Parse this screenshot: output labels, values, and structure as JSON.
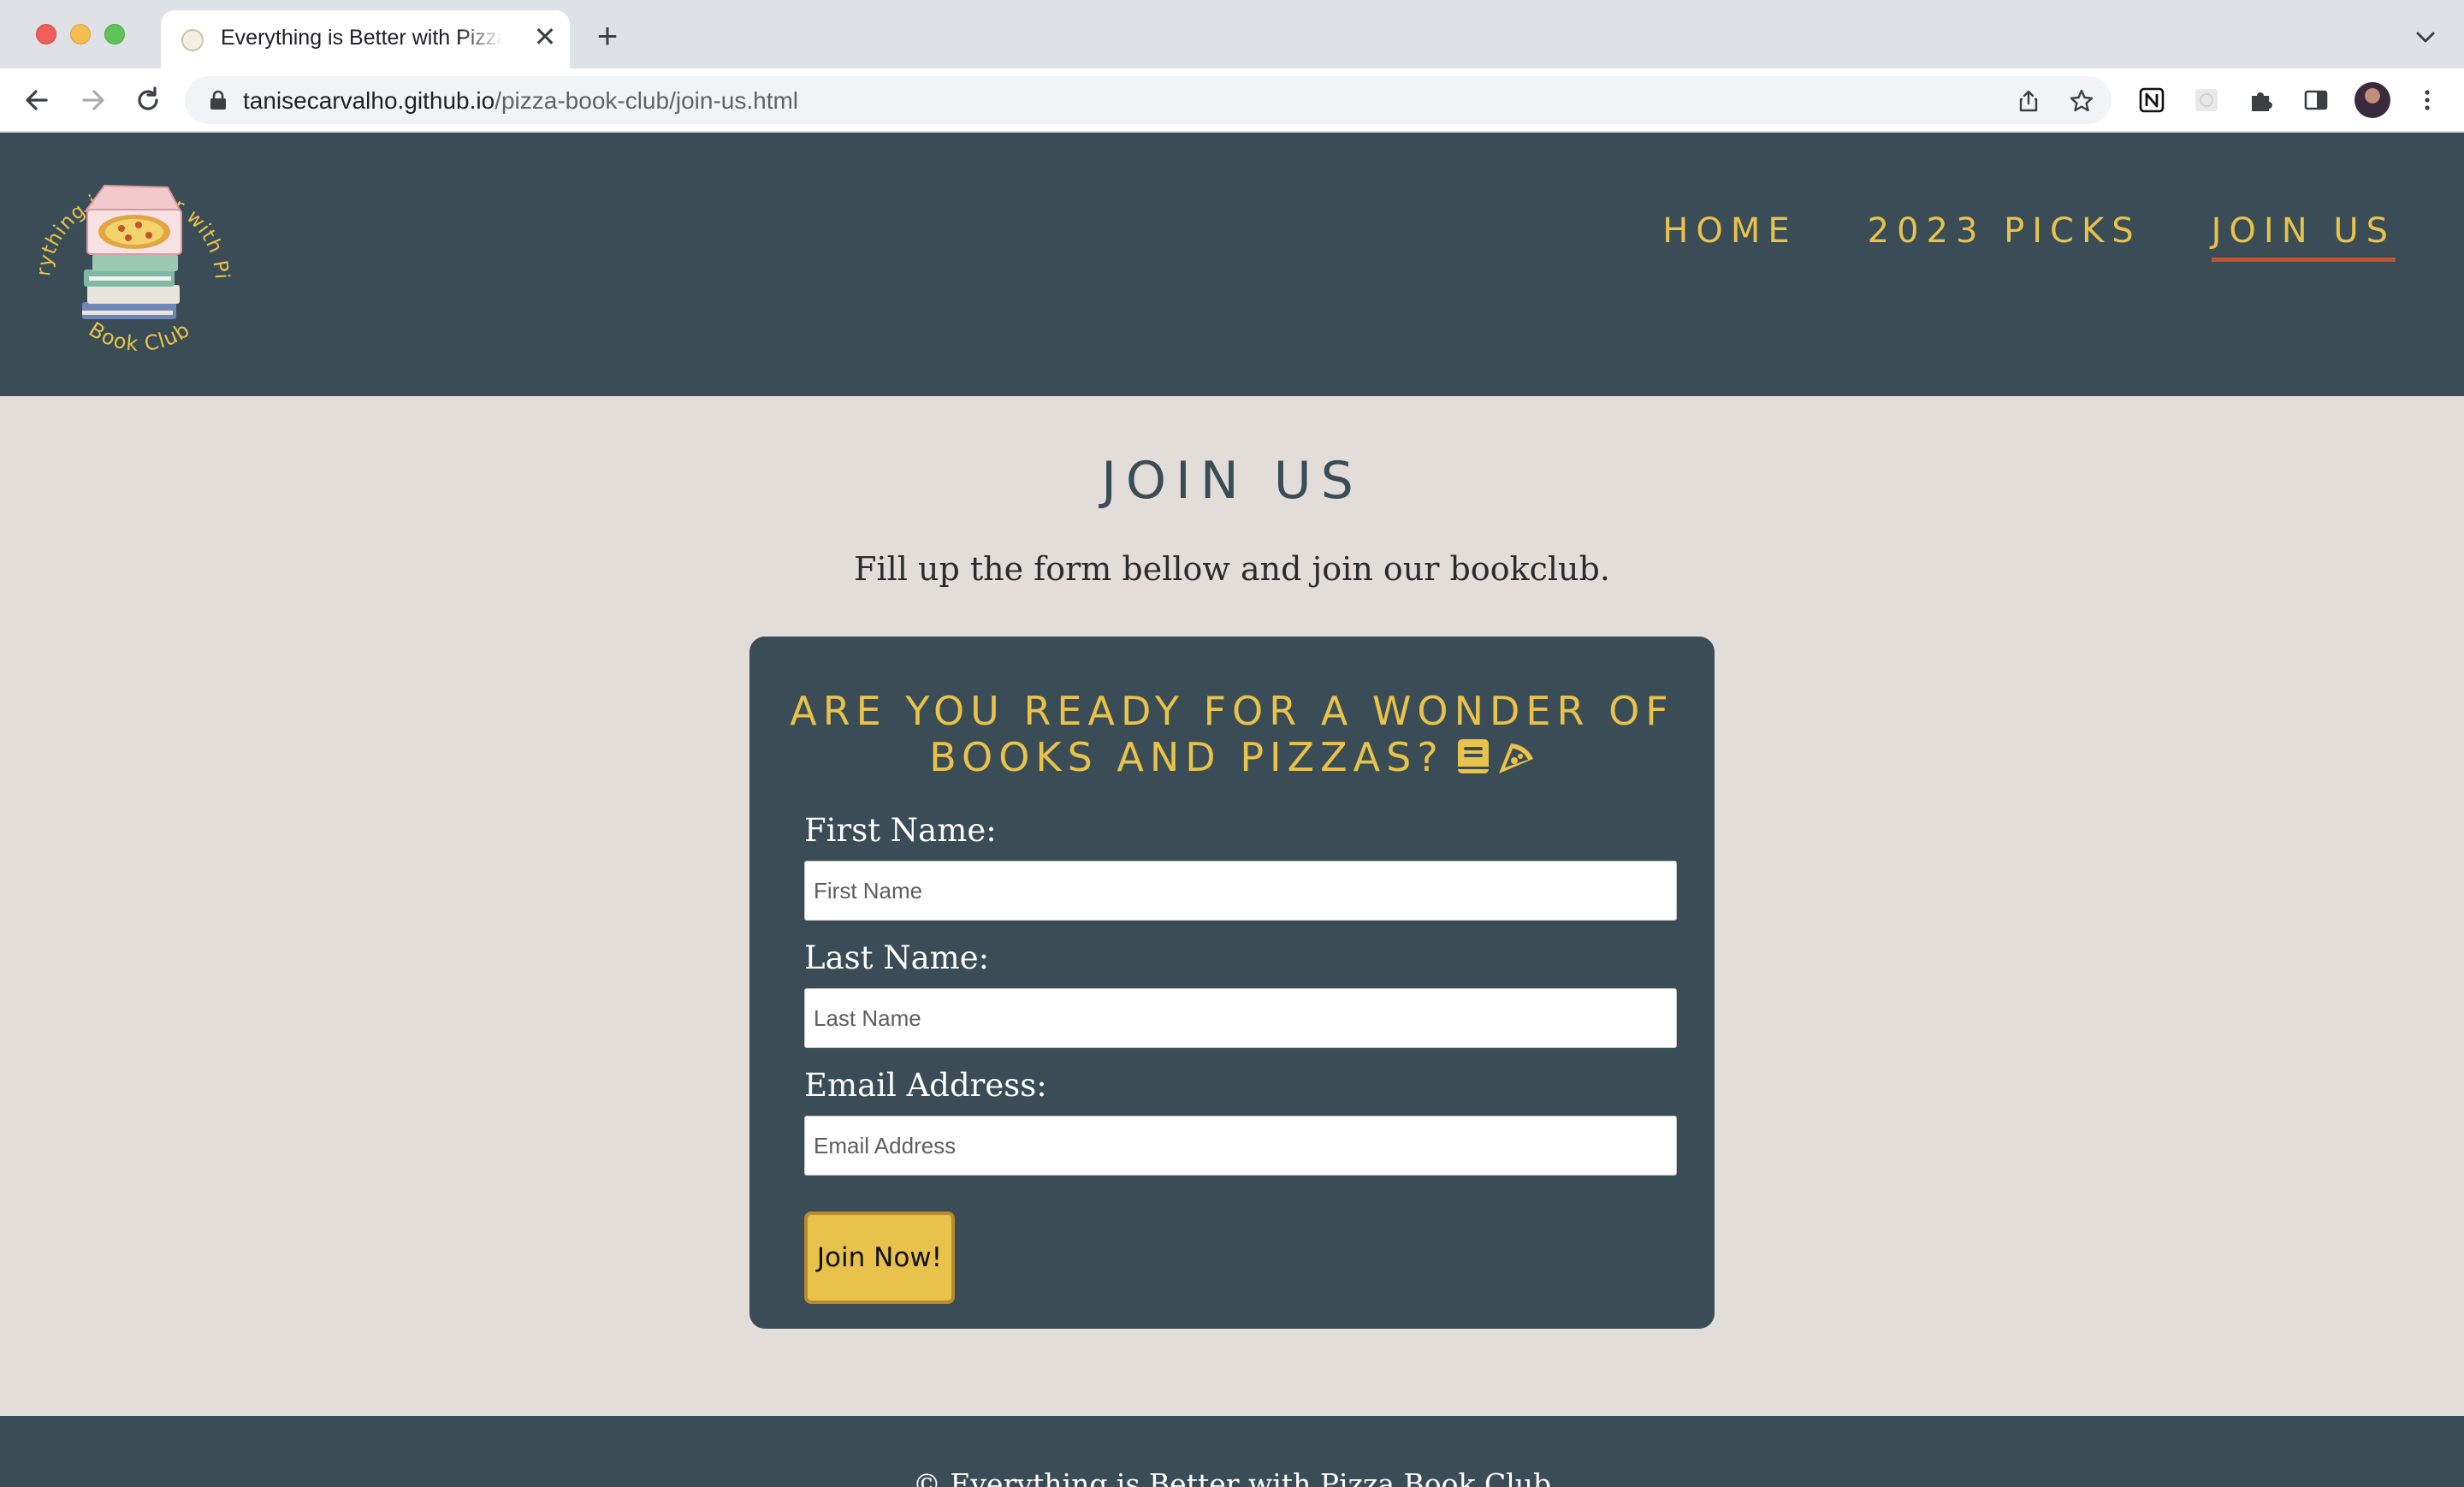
{
  "browser": {
    "tab_title": "Everything is Better with Pizza Book Club",
    "tab_close": "✕",
    "new_tab": "+",
    "url_host": "tanisecarvalho.github.io",
    "url_path": "/pizza-book-club/join-us.html"
  },
  "header": {
    "logo": {
      "arc_top": "Everything is Better with Pizza",
      "arc_bottom": "Book Club"
    },
    "nav": [
      {
        "label": "HOME"
      },
      {
        "label": "2023 PICKS"
      },
      {
        "label": "JOIN US",
        "active": true
      }
    ]
  },
  "main": {
    "title": "JOIN US",
    "intro": "Fill up the form bellow and join our bookclub.",
    "form": {
      "heading": "ARE YOU READY FOR A WONDER OF BOOKS AND PIZZAS?",
      "heading_icons": [
        "book-icon",
        "pizza-icon"
      ],
      "fields": [
        {
          "label": "First Name:",
          "placeholder": "First Name",
          "value": ""
        },
        {
          "label": "Last Name:",
          "placeholder": "Last Name",
          "value": ""
        },
        {
          "label": "Email Address:",
          "placeholder": "Email Address",
          "value": ""
        }
      ],
      "submit_label": "Join Now!"
    }
  },
  "footer": {
    "text": "© Everything is Better with Pizza Book Club"
  },
  "colors": {
    "header_bg": "#3a4d57",
    "accent_yellow": "#e8c24a",
    "active_underline": "#c1532e",
    "page_bg": "#e2ddd9"
  }
}
